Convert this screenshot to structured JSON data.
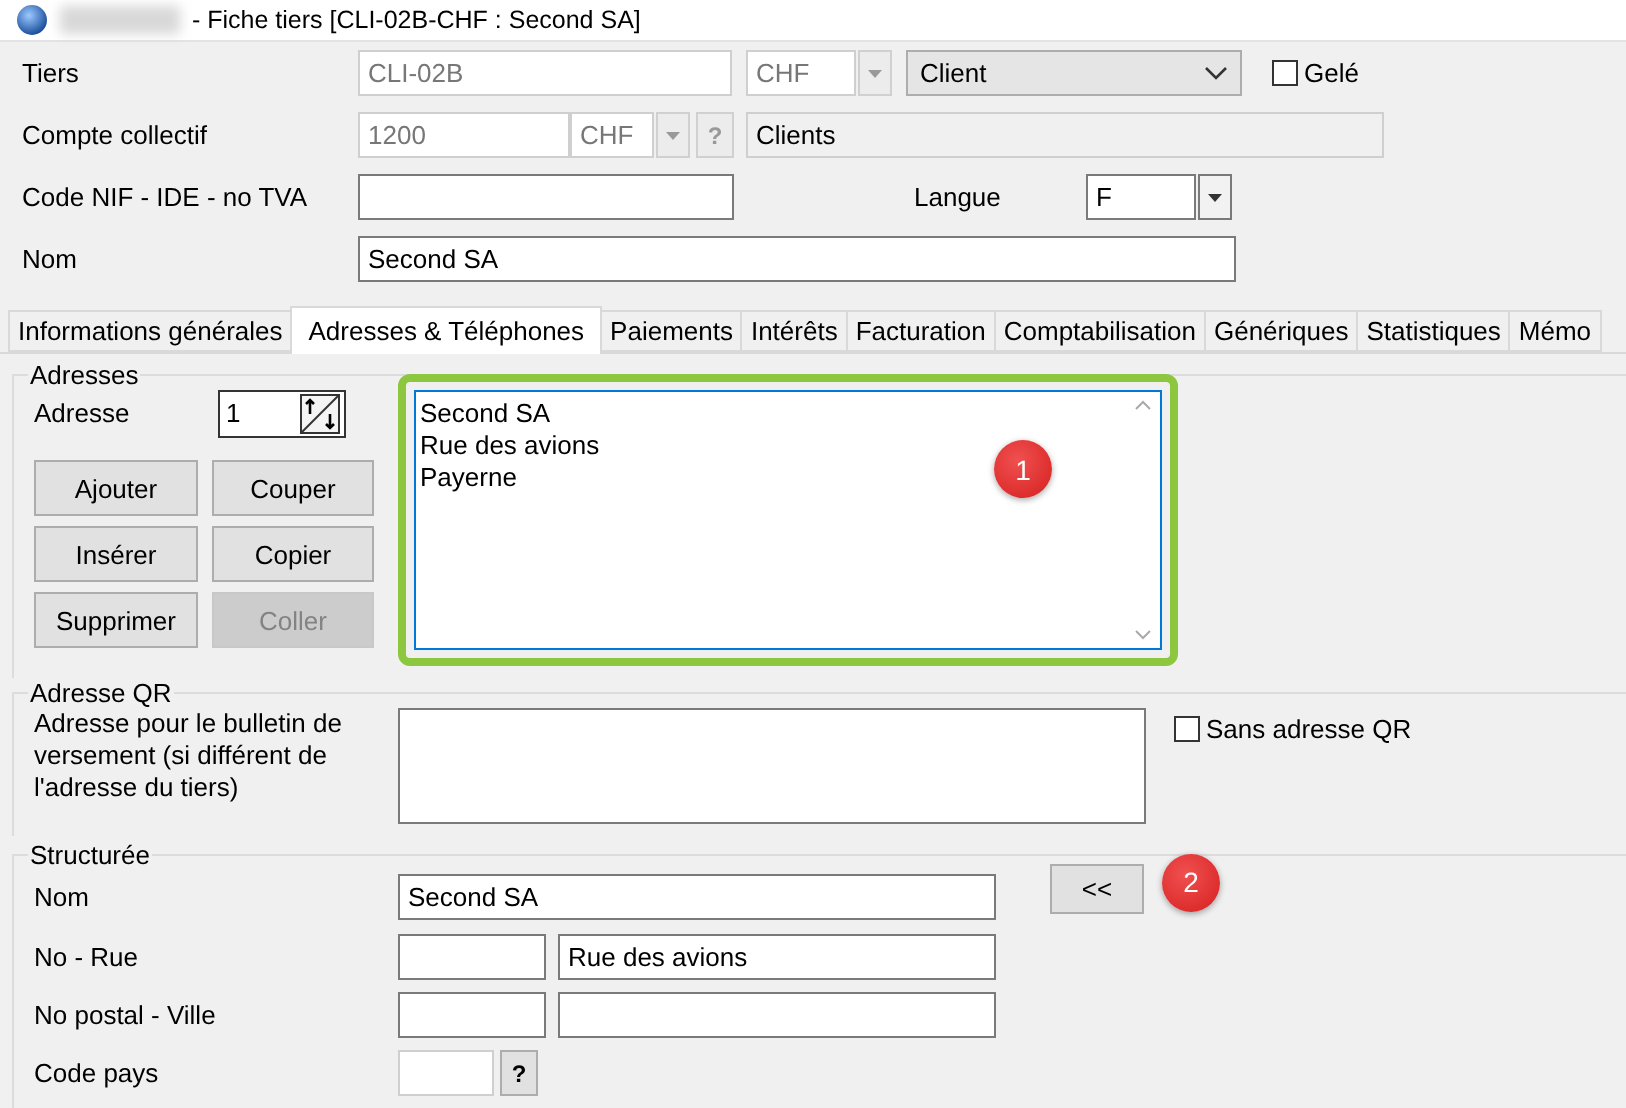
{
  "window": {
    "title": "- Fiche tiers [CLI-02B-CHF : Second SA]"
  },
  "header": {
    "tiers": {
      "label": "Tiers",
      "code": "CLI-02B",
      "currency": "CHF",
      "type": "Client",
      "frozen_label": "Gelé",
      "frozen": false
    },
    "account": {
      "label": "Compte collectif",
      "number": "1200",
      "currency": "CHF",
      "help": "?",
      "name": "Clients"
    },
    "vat": {
      "label": "Code NIF - IDE - no TVA",
      "language_label": "Langue",
      "language": "F"
    },
    "name": {
      "label": "Nom",
      "value": "Second SA"
    }
  },
  "tabs": [
    {
      "label": "Informations générales",
      "selected": false
    },
    {
      "label": "Adresses & Téléphones",
      "selected": true
    },
    {
      "label": "Paiements",
      "selected": false
    },
    {
      "label": "Intérêts",
      "selected": false
    },
    {
      "label": "Facturation",
      "selected": false
    },
    {
      "label": "Comptabilisation",
      "selected": false
    },
    {
      "label": "Génériques",
      "selected": false
    },
    {
      "label": "Statistiques",
      "selected": false
    },
    {
      "label": "Mémo",
      "selected": false
    }
  ],
  "addresses": {
    "title": "Adresses",
    "number_label": "Adresse",
    "number": "1",
    "highlighted": true,
    "buttons": [
      {
        "label": "Ajouter",
        "disabled": false
      },
      {
        "label": "Couper",
        "disabled": false
      },
      {
        "label": "Insérer",
        "disabled": false
      },
      {
        "label": "Copier",
        "disabled": false
      },
      {
        "label": "Supprimer",
        "disabled": false
      },
      {
        "label": "Coller",
        "disabled": true
      }
    ],
    "lines": [
      "Second SA",
      "Rue des avions",
      "Payerne"
    ]
  },
  "qr": {
    "title": "Adresse QR",
    "label": "Adresse pour le bulletin de versement (si différent de l'adresse du tiers)",
    "without_label": "Sans adresse QR",
    "without": false
  },
  "structured": {
    "title": "Structurée",
    "copy_button": "<<",
    "name_label": "Nom",
    "name": "Second SA",
    "street_label": "No - Rue",
    "street": "Rue des avions",
    "city_label": "No postal - Ville",
    "country_label": "Code pays",
    "help": "?"
  },
  "markers": [
    {
      "number": "1"
    },
    {
      "number": "2"
    }
  ]
}
